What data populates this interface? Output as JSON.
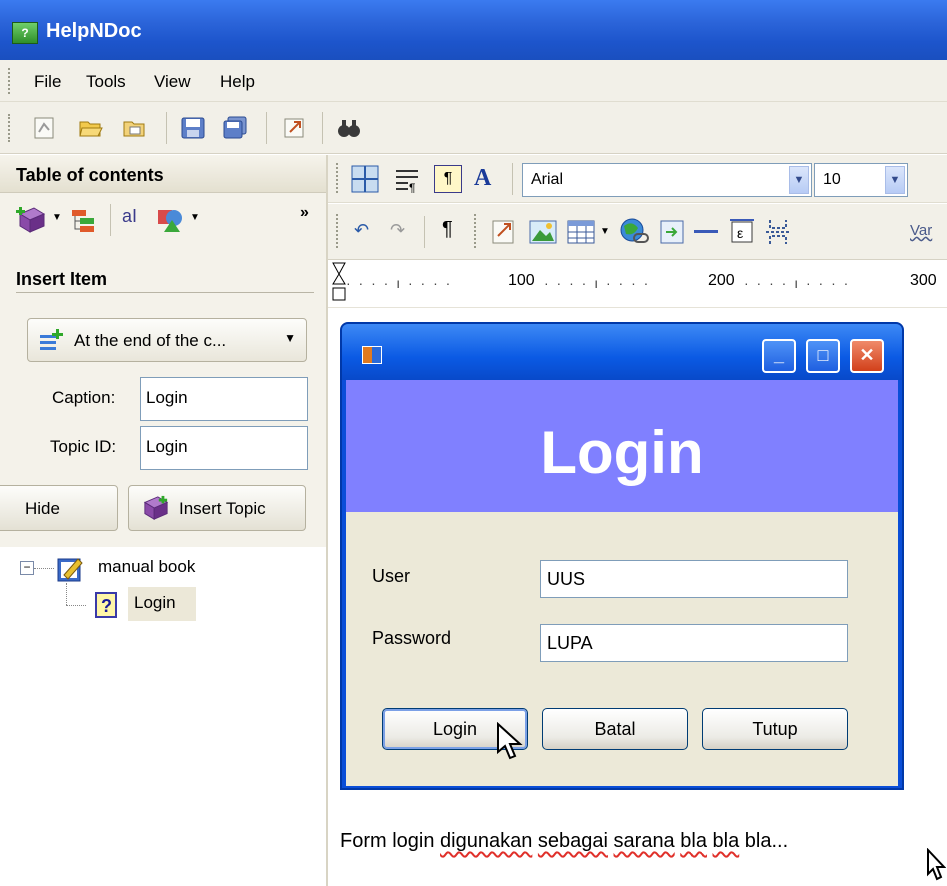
{
  "app": {
    "title": "HelpNDoc",
    "icon": "app-icon"
  },
  "menu": {
    "items": [
      "File",
      "Tools",
      "View",
      "Help"
    ]
  },
  "toc": {
    "title": "Table of contents",
    "insert_title": "Insert Item",
    "position_button": "At the end of the c...",
    "caption_label": "Caption:",
    "caption_value": "Login",
    "topic_label": "Topic ID:",
    "topic_value": "Login",
    "hide_label": "Hide",
    "insert_topic_label": "Insert Topic",
    "tree": {
      "root": "manual book",
      "child": "Login"
    }
  },
  "format": {
    "font": "Arial",
    "size": "10",
    "var_label": "Var"
  },
  "ruler": {
    "marks": [
      "100",
      "200",
      "300"
    ]
  },
  "login_window": {
    "banner": "Login",
    "user_label": "User",
    "user_value": "UUS",
    "password_label": "Password",
    "password_value": "LUPA",
    "buttons": {
      "login": "Login",
      "cancel": "Batal",
      "close": "Tutup"
    },
    "minimize_glyph": "_",
    "maximize_glyph": "□",
    "close_glyph": "✕"
  },
  "caption": {
    "before": "Form login ",
    "w1": "digunakan",
    "w2": "sebagai",
    "w3": "sarana",
    "w4": "bla",
    "w5": "bla",
    "after": " bla..."
  },
  "colors": {
    "banner": "#8080ff",
    "titlebar": "#2a63d8",
    "window_frame": "#0a4ed8"
  }
}
